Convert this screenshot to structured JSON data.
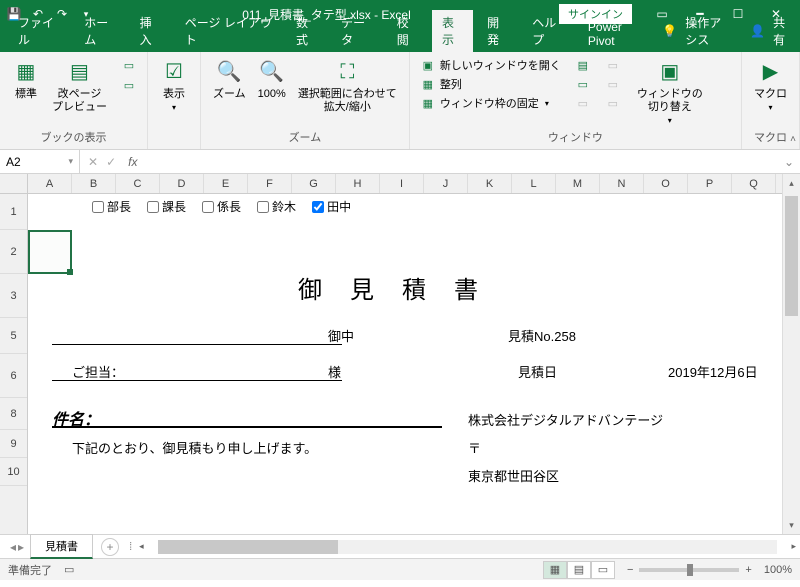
{
  "titlebar": {
    "filename": "011_見積書_タテ型.xlsx - Excel",
    "signin": "サインイン"
  },
  "tabs": {
    "items": [
      "ファイル",
      "ホーム",
      "挿入",
      "ページ レイアウト",
      "数式",
      "データ",
      "校閲",
      "表示",
      "開発",
      "ヘルプ",
      "Power Pivot"
    ],
    "tell_me": "操作アシス",
    "share": "共有"
  },
  "ribbon": {
    "g1": {
      "normal": "標準",
      "pagebreak": "改ページ\nプレビュー",
      "label": "ブックの表示",
      "display": "表示"
    },
    "g2": {
      "zoom": "ズーム",
      "hundred": "100%",
      "fit": "選択範囲に合わせて\n拡大/縮小",
      "label": "ズーム"
    },
    "g3": {
      "newwin": "新しいウィンドウを開く",
      "arrange": "整列",
      "freeze": "ウィンドウ枠の固定",
      "switch": "ウィンドウの\n切り替え",
      "label": "ウィンドウ"
    },
    "g4": {
      "macro": "マクロ",
      "label": "マクロ"
    }
  },
  "namebox": {
    "ref": "A2"
  },
  "columns": [
    "A",
    "B",
    "C",
    "D",
    "E",
    "F",
    "G",
    "H",
    "I",
    "J",
    "K",
    "L",
    "M",
    "N",
    "O",
    "P",
    "Q"
  ],
  "rows": [
    "1",
    "2",
    "3",
    "5",
    "6",
    "8",
    "9",
    "10"
  ],
  "checks": [
    {
      "label": "部長",
      "checked": false
    },
    {
      "label": "課長",
      "checked": false
    },
    {
      "label": "係長",
      "checked": false
    },
    {
      "label": "鈴木",
      "checked": false
    },
    {
      "label": "田中",
      "checked": true
    }
  ],
  "doc": {
    "title": "御見積書",
    "onchu": "御中",
    "tanto_label": "ご担当：",
    "sama": "様",
    "quote_no_label": "見積No.258",
    "quote_date_label": "見積日",
    "quote_date": "2019年12月6日",
    "subject_label": "件名：",
    "body1": "下記のとおり、御見積もり申し上げます。",
    "company": "株式会社デジタルアドバンテージ",
    "postal": "〒",
    "address": "東京都世田谷区"
  },
  "sheettabs": {
    "active": "見積書"
  },
  "status": {
    "ready": "準備完了",
    "zoom": "100%"
  }
}
